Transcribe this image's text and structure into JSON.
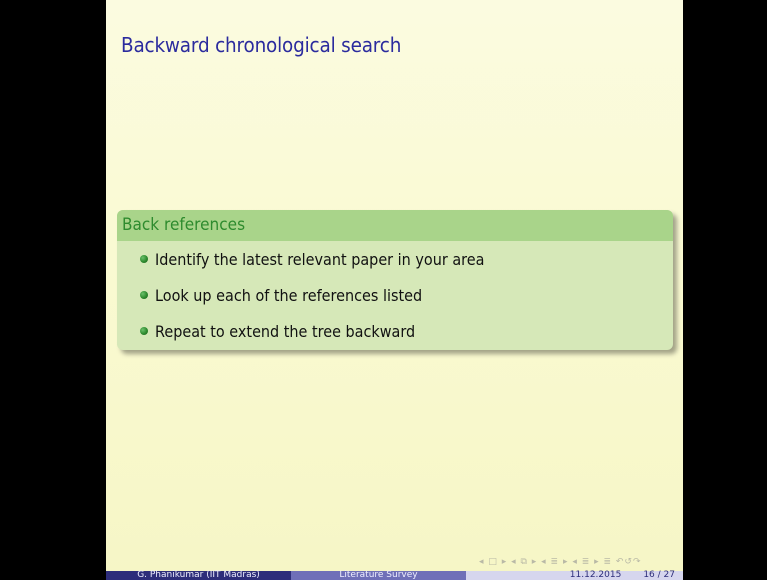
{
  "slide": {
    "title": "Backward chronological search",
    "block": {
      "heading": "Back references",
      "items": [
        "Identify the latest relevant paper in your area",
        "Look up each of the references listed",
        "Repeat to extend the tree backward"
      ]
    }
  },
  "navigation": {
    "symbols": "◂ □ ▸ ◂ ⧉ ▸ ◂ ≣ ▸ ◂ ≣ ▸   ≣   ↶↺↷"
  },
  "footer": {
    "author": "G. Phanikumar  (IIT Madras)",
    "talk_title": "Literature Survey",
    "date": "11.12.2015",
    "page": "16 / 27"
  },
  "colors": {
    "background": "#000000",
    "slide_background": "#fafad2",
    "title": "#2b2b9e",
    "block_header": "#a9d48a",
    "block_header_text": "#2e8b2e",
    "block_body": "#d6e8b8",
    "footer_dark": "#2d2d7a",
    "footer_mid": "#6f6fb8",
    "footer_light": "#d6d6ee"
  }
}
